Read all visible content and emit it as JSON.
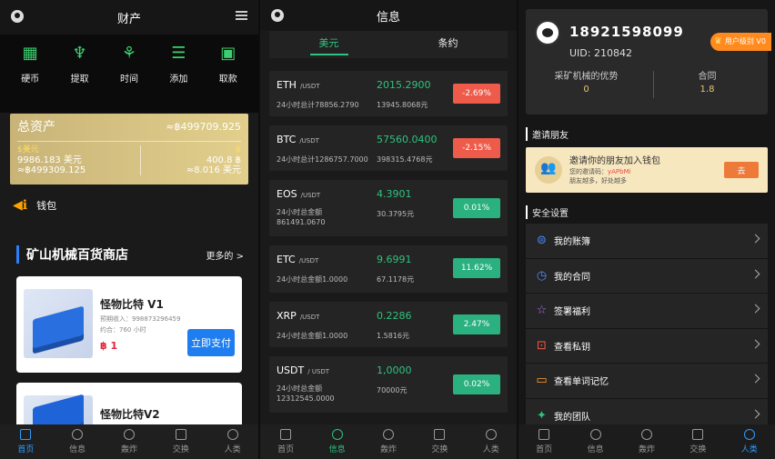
{
  "s1": {
    "header_title": "财产",
    "quick": [
      {
        "label": "硬币",
        "icon": "qr-icon"
      },
      {
        "label": "提取",
        "icon": "withdraw-icon"
      },
      {
        "label": "时间",
        "icon": "network-icon"
      },
      {
        "label": "添加",
        "icon": "list-icon"
      },
      {
        "label": "取款",
        "icon": "wallet-icon"
      }
    ],
    "asset": {
      "total_label": "总资产",
      "total_value": "≈฿499709.925",
      "left_icon": "$美元",
      "left_v1": "9986.183 美元",
      "left_v2": "≈฿499309.125",
      "right_icon": "฿",
      "right_v1": "400.8 ฿",
      "right_v2": "≈8.016 美元"
    },
    "wallet_label": "钱包",
    "section_title": "矿山机械百货商店",
    "more": "更多的  >",
    "products": [
      {
        "name": "怪物比特 V1",
        "sub1": "预期收入：998873296459",
        "sub2": "约合：760 小时",
        "price": "฿ 1",
        "pay": "立即支付"
      },
      {
        "name": "怪物比特V2",
        "sub1": "",
        "sub2": "",
        "price": "",
        "pay": ""
      }
    ],
    "tabs": [
      "首页",
      "信息",
      "轰炸",
      "交换",
      "人类"
    ]
  },
  "s2": {
    "header_title": "信息",
    "seg": [
      "美元",
      "条约"
    ],
    "coins": [
      {
        "sym": "ETH",
        "pair": "/USDT",
        "vol": "24小时总计78856.2790",
        "price": "2015.2900",
        "cny": "13945.8068元",
        "chg": "-2.69%",
        "dir": "neg"
      },
      {
        "sym": "BTC",
        "pair": "/USDT",
        "vol": "24小时总计1286757.7000",
        "price": "57560.0400",
        "cny": "398315.4768元",
        "chg": "-2.15%",
        "dir": "neg"
      },
      {
        "sym": "EOS",
        "pair": "/USDT",
        "vol": "24小时总金额861491.0670",
        "price": "4.3901",
        "cny": "30.3795元",
        "chg": "0.01%",
        "dir": "pos"
      },
      {
        "sym": "ETC",
        "pair": "/USDT",
        "vol": "24小时总金额1.0000",
        "price": "9.6991",
        "cny": "67.1178元",
        "chg": "11.62%",
        "dir": "pos"
      },
      {
        "sym": "XRP",
        "pair": "/USDT",
        "vol": "24小时总金额1.0000",
        "price": "0.2286",
        "cny": "1.5816元",
        "chg": "2.47%",
        "dir": "pos"
      },
      {
        "sym": "USDT",
        "pair": "/ USDT",
        "vol": "24小时总金额12312545.0000",
        "price": "1,0000",
        "cny": "70000元",
        "chg": "0.02%",
        "dir": "pos"
      }
    ],
    "tabs": [
      "首页",
      "信息",
      "轰炸",
      "交换",
      "人类"
    ]
  },
  "s3": {
    "phone": "18921598099",
    "uid": "UID: 210842",
    "level": "用户级别 V0",
    "stat1_label": "采矿机械的优势",
    "stat1_value": "0",
    "stat2_label": "合同",
    "stat2_value": "1.8",
    "invite_title": "邀请朋友",
    "invite_text": "邀请你的朋友加入钱包",
    "invite_code_label": "您的邀请码：",
    "invite_code": "yAPbMi",
    "invite_note": "朋友越多，好处越多",
    "invite_btn": "去",
    "security_title": "安全设置",
    "menu": [
      {
        "label": "我的账簿",
        "icon": "ledger-icon"
      },
      {
        "label": "我的合同",
        "icon": "contract-icon"
      },
      {
        "label": "签署福利",
        "icon": "star-icon"
      },
      {
        "label": "查看私钥",
        "icon": "key-icon"
      },
      {
        "label": "查看单词记忆",
        "icon": "wallet-icon"
      },
      {
        "label": "我的团队",
        "icon": "team-icon"
      }
    ],
    "tabs": [
      "首页",
      "信息",
      "轰炸",
      "交换",
      "人类"
    ]
  },
  "colors": {
    "green": "#2ec27e",
    "red": "#ef5b4b",
    "gold": "#e2cf8c",
    "blue": "#2d7ff9",
    "orange": "#ff8a1d"
  }
}
